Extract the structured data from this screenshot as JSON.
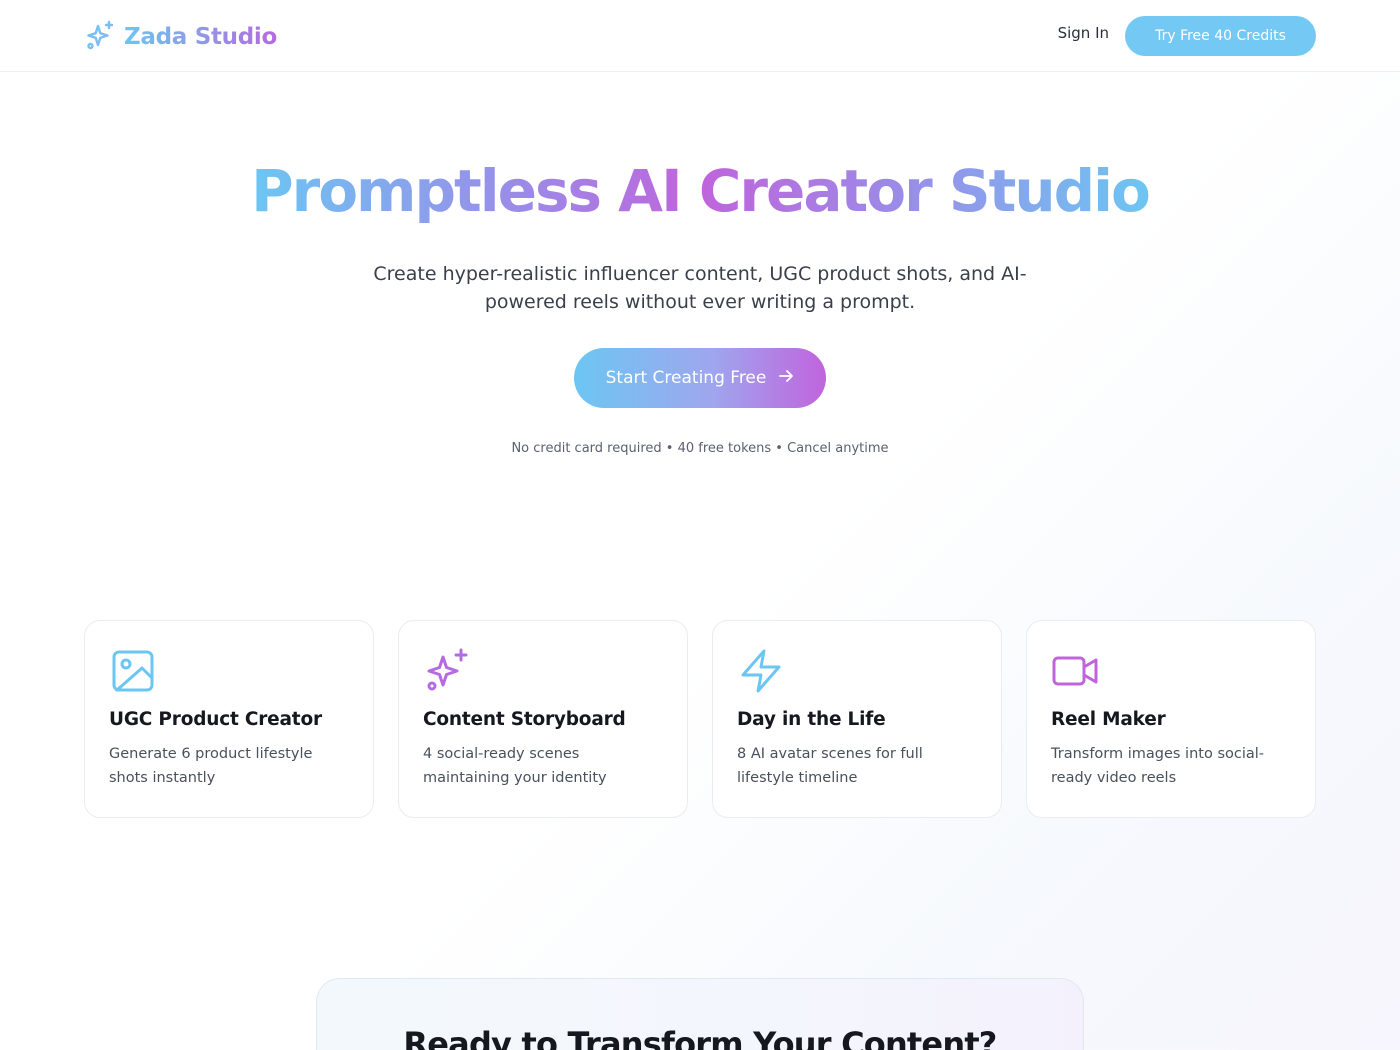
{
  "nav": {
    "brand": "Zada Studio",
    "signin_label": "Sign In",
    "cta_label": "Try Free 40 Credits"
  },
  "hero": {
    "title": "Promptless AI Creator Studio",
    "subtitle": "Create hyper-realistic influencer content, UGC product shots, and AI-powered reels without ever writing a prompt.",
    "cta_label": "Start Creating Free",
    "fineprint": "No credit card required • 40 free tokens • Cancel anytime"
  },
  "features": [
    {
      "icon": "image-icon",
      "title": "UGC Product Creator",
      "description": "Generate 6 product lifestyle shots instantly"
    },
    {
      "icon": "sparkles-icon",
      "title": "Content Storyboard",
      "description": "4 social-ready scenes maintaining your identity"
    },
    {
      "icon": "lightning-icon",
      "title": "Day in the Life",
      "description": "8 AI avatar scenes for full lifestyle timeline"
    },
    {
      "icon": "video-camera-icon",
      "title": "Reel Maker",
      "description": "Transform images into social-ready video reels"
    }
  ],
  "bottom_section": {
    "title": "Ready to Transform Your Content?"
  },
  "colors": {
    "brand_blue": "#6cc6f2",
    "brand_purple": "#c064dc",
    "button_blue": "#74c9f4"
  }
}
